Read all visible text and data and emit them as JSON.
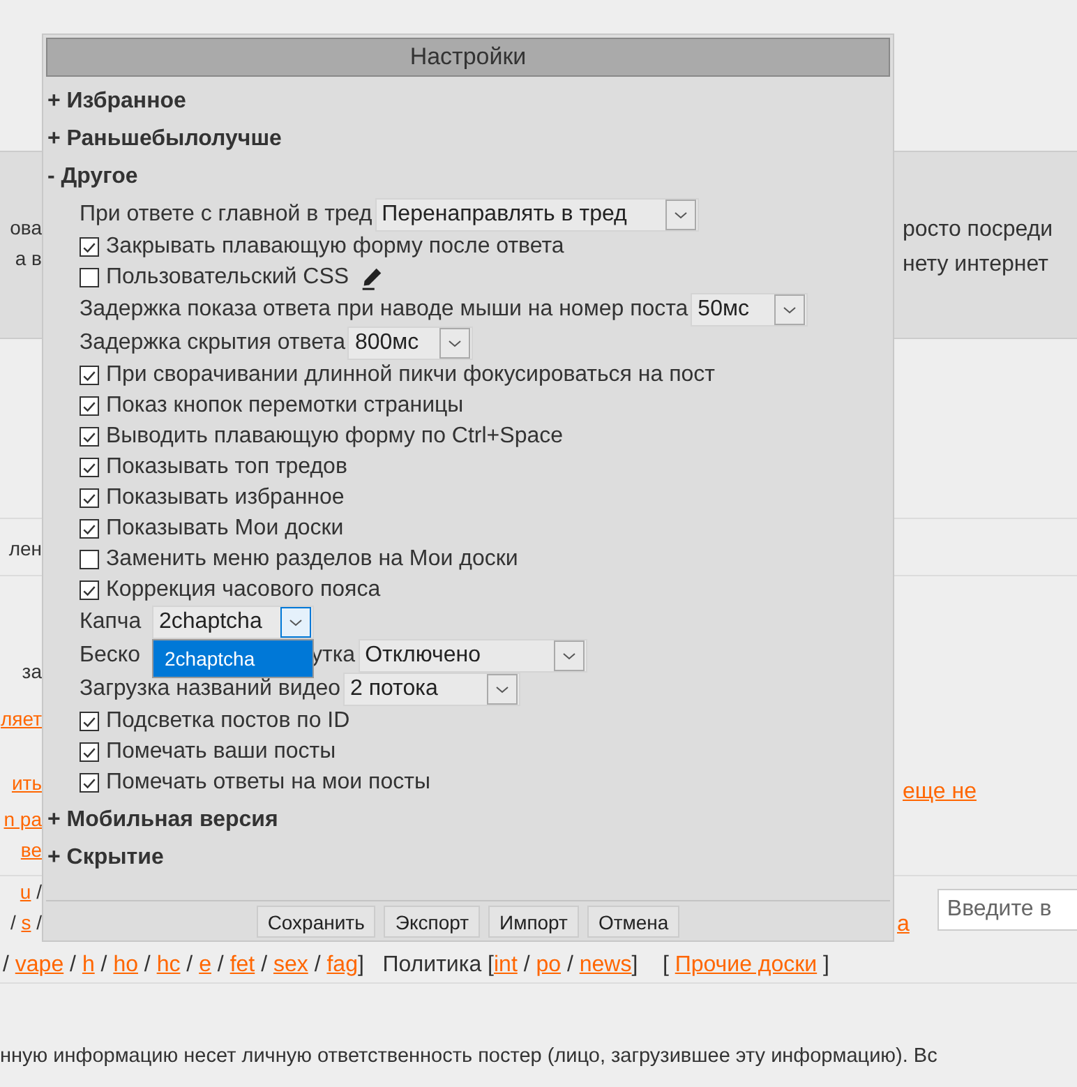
{
  "background": {
    "banner_left": [
      "ова",
      "а в"
    ],
    "banner_right": [
      "росто посреди",
      "нету интернет"
    ],
    "row_left": "лен",
    "left_fragments": [
      {
        "kind": "text",
        "text": "за"
      },
      {
        "kind": "link",
        "text": "ляет"
      },
      {
        "kind": "link",
        "text": "ить"
      },
      {
        "kind": "link",
        "text": "n ра"
      },
      {
        "kind": "link",
        "text": "ве"
      }
    ],
    "right_link": "еще не",
    "board_left": [
      [
        {
          "kind": "link",
          "text": "u"
        },
        {
          "kind": "text",
          "text": " /"
        }
      ],
      [
        {
          "kind": "text",
          "text": "/ "
        },
        {
          "kind": "link",
          "text": "s"
        },
        {
          "kind": "text",
          "text": " /"
        }
      ]
    ],
    "board_right_link": "а",
    "search": {
      "placeholder": "Введите в"
    },
    "nav": [
      {
        "kind": "text",
        "text": "/ "
      },
      {
        "kind": "link",
        "text": "vape"
      },
      {
        "kind": "text",
        "text": " / "
      },
      {
        "kind": "link",
        "text": "h"
      },
      {
        "kind": "text",
        "text": " / "
      },
      {
        "kind": "link",
        "text": "ho"
      },
      {
        "kind": "text",
        "text": " / "
      },
      {
        "kind": "link",
        "text": "hc"
      },
      {
        "kind": "text",
        "text": " / "
      },
      {
        "kind": "link",
        "text": "e"
      },
      {
        "kind": "text",
        "text": " / "
      },
      {
        "kind": "link",
        "text": "fet"
      },
      {
        "kind": "text",
        "text": " / "
      },
      {
        "kind": "link",
        "text": "sex"
      },
      {
        "kind": "text",
        "text": " / "
      },
      {
        "kind": "link",
        "text": "fag"
      },
      {
        "kind": "text",
        "text": "]   Политика ["
      },
      {
        "kind": "link",
        "text": "int"
      },
      {
        "kind": "text",
        "text": " / "
      },
      {
        "kind": "link",
        "text": "po"
      },
      {
        "kind": "text",
        "text": " / "
      },
      {
        "kind": "link",
        "text": "news"
      },
      {
        "kind": "text",
        "text": "]    [ "
      },
      {
        "kind": "link",
        "text": "Прочие доски"
      },
      {
        "kind": "text",
        "text": " ]"
      }
    ],
    "footer_text": "нную информацию несет личную ответственность постер (лицо, загрузившее эту информацию). Вс"
  },
  "settings_window": {
    "title": "Настройки",
    "sections": [
      {
        "marker": "+",
        "title": "Избранное"
      },
      {
        "marker": "+",
        "title": "Раньшебылолучше"
      },
      {
        "marker": "-",
        "title": "Другое",
        "settings": [
          {
            "kind": "select",
            "label": "При ответе с главной в тред",
            "value": "Перенаправлять в тред",
            "expanded": false
          },
          {
            "kind": "checkbox",
            "label": "Закрывать плавающую форму после ответа",
            "checked": true
          },
          {
            "kind": "checkbox",
            "label": "Пользовательский CSS",
            "checked": false,
            "editable": true
          },
          {
            "kind": "select",
            "label": "Задержка показа ответа при наводе мыши на номер поста",
            "value": "50мс",
            "expanded": false
          },
          {
            "kind": "select",
            "label": "Задержка скрытия ответа",
            "value": "800мс",
            "expanded": false
          },
          {
            "kind": "checkbox",
            "label": "При сворачивании длинной пикчи фокусироваться на пост",
            "checked": true
          },
          {
            "kind": "checkbox",
            "label": "Показ кнопок перемотки страницы",
            "checked": true
          },
          {
            "kind": "checkbox",
            "label": "Выводить плавающую форму по Ctrl+Space",
            "checked": true
          },
          {
            "kind": "checkbox",
            "label": "Показывать топ тредов",
            "checked": true
          },
          {
            "kind": "checkbox",
            "label": "Показывать избранное",
            "checked": true
          },
          {
            "kind": "checkbox",
            "label": "Показывать Мои доски",
            "checked": true
          },
          {
            "kind": "checkbox",
            "label": "Заменить меню разделов на Мои доски",
            "checked": false
          },
          {
            "kind": "checkbox",
            "label": "Коррекция часового пояса",
            "checked": true
          },
          {
            "kind": "select",
            "label": "Капча",
            "value": "2chaptcha",
            "expanded": true,
            "options": [
              {
                "label": "2chaptcha",
                "selected": true
              }
            ]
          },
          {
            "kind": "select",
            "label_parts": [
              "Беско",
              "утка"
            ],
            "value": "Отключено",
            "expanded": false
          },
          {
            "kind": "select",
            "label": "Загрузка названий видео",
            "value": "2 потока",
            "expanded": false
          },
          {
            "kind": "checkbox",
            "label": "Подсветка постов по ID",
            "checked": true
          },
          {
            "kind": "checkbox",
            "label": "Помечать ваши посты",
            "checked": true
          },
          {
            "kind": "checkbox",
            "label": "Помечать ответы на мои посты",
            "checked": true
          }
        ]
      },
      {
        "marker": "+",
        "title": "Мобильная версия"
      },
      {
        "marker": "+",
        "title": "Скрытие"
      }
    ],
    "buttons": [
      "Сохранить",
      "Экспорт",
      "Импорт",
      "Отмена"
    ]
  }
}
